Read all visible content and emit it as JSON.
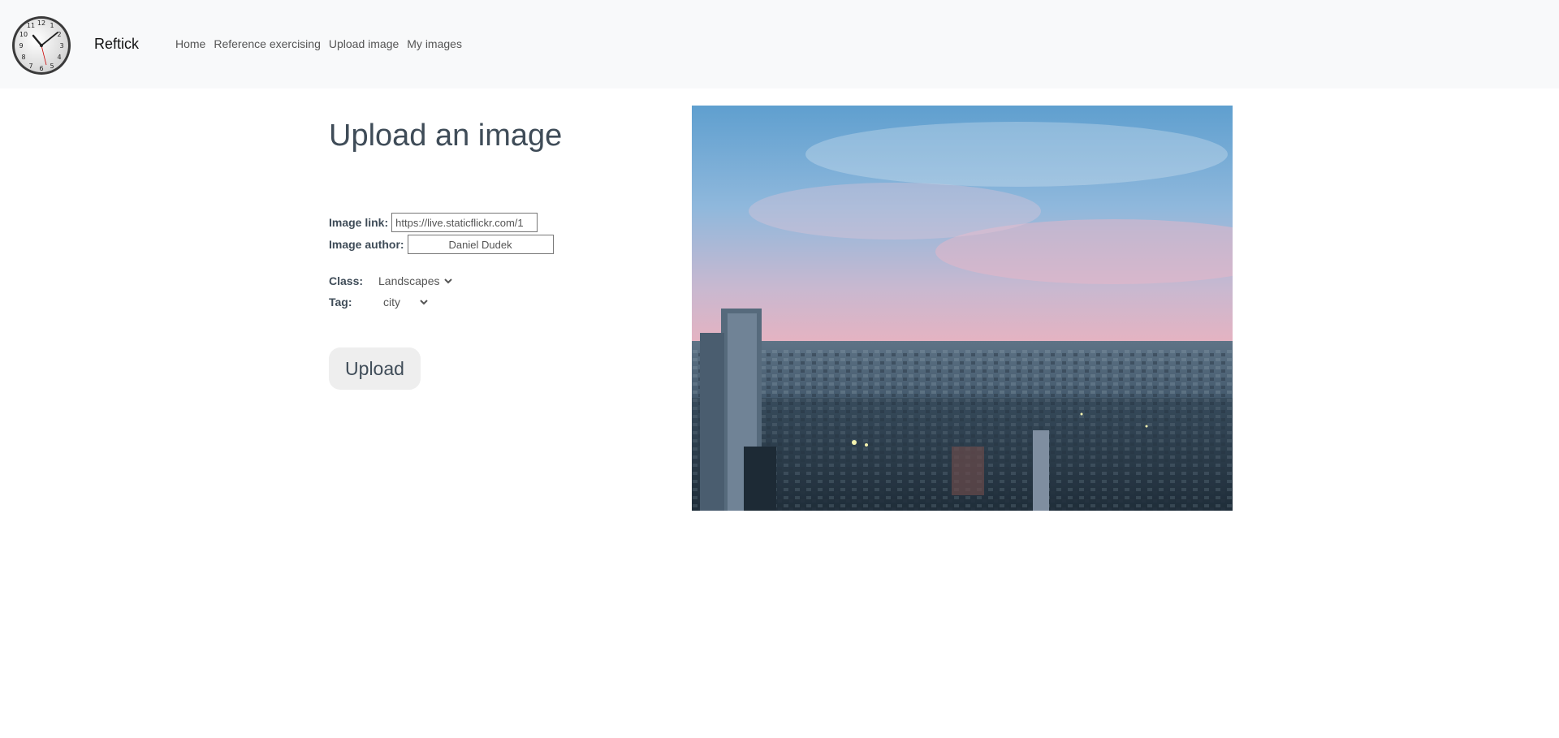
{
  "nav": {
    "brand": "Reftick",
    "links": [
      "Home",
      "Reference exercising",
      "Upload image",
      "My images"
    ]
  },
  "page": {
    "title": "Upload an image"
  },
  "form": {
    "image_link_label": "Image link:",
    "image_link_value": "https://live.staticflickr.com/1",
    "image_author_label": "Image author:",
    "image_author_value": "Daniel Dudek",
    "class_label": "Class:",
    "class_value": "Landscapes",
    "tag_label": "Tag:",
    "tag_value": "city",
    "upload_label": "Upload"
  },
  "colors": {
    "nav_bg": "#f8f9fa",
    "button_bg": "#eeeeee",
    "text": "#3f4c58"
  }
}
